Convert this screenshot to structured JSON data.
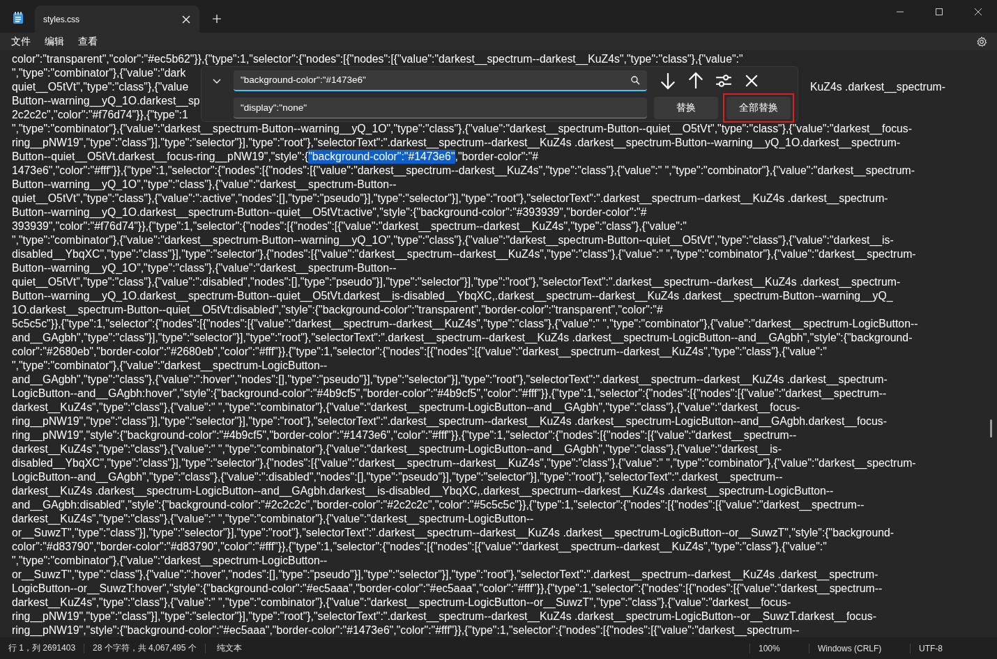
{
  "window": {
    "tab_title": "styles.css",
    "tab_selected": true
  },
  "menu": [
    "文件",
    "编辑",
    "查看"
  ],
  "find_panel": {
    "find_value": "\"background-color\":\"#1473e6\"",
    "replace_value": "\"display\":\"none\"",
    "replace_button": "替换",
    "replace_all_button": "全部替换",
    "replace_all_outlined": true
  },
  "editor_lines": [
    {
      "text": "color\":\"transparent\",\"color\":\"#ec5b62\"}},{\"type\":1,\"selector\":{\"nodes\":[{\"nodes\":[{\"value\":\"darkest__spectrum--darkest__KuZ4s\",\"type\":\"class\"},{\"value\":\""
    },
    {
      "text": "\",\"type\":\"combinator\"},{\"value\":\"dark"
    },
    {
      "text": "quiet__O5tVt\",\"type\":\"class\"},{\"value",
      "right": "KuZ4s .darkest__spectrum-"
    },
    {
      "text": "Button--warning__yQ_1O.darkest__sp"
    },
    {
      "text": "2c2c2c\",\"color\":\"#f76d74\"}},{\"type\":1"
    },
    {
      "text": "\",\"type\":\"combinator\"},{\"value\":\"darkest__spectrum-Button--warning__yQ_1O\",\"type\":\"class\"},{\"value\":\"darkest__spectrum-Button--quiet__O5tVt\",\"type\":\"class\"},{\"value\":\"darkest__focus-"
    },
    {
      "text": "ring__pNW19\",\"type\":\"class\"}],\"type\":\"selector\"}],\"type\":\"root\"},\"selectorText\":\".darkest__spectrum--darkest__KuZ4s .darkest__spectrum-Button--warning__yQ_1O.darkest__spectrum-"
    },
    {
      "text": "Button--quiet__O5tVt.darkest__focus-ring__pNW19\",\"style\":{",
      "match": "\"background-color\":\"#1473e6\"",
      "after": ",\"border-color\":\"#"
    },
    {
      "text": "1473e6\",\"color\":\"#fff\"}},{\"type\":1,\"selector\":{\"nodes\":[{\"nodes\":[{\"value\":\"darkest__spectrum--darkest__KuZ4s\",\"type\":\"class\"},{\"value\":\" \",\"type\":\"combinator\"},{\"value\":\"darkest__spectrum-"
    },
    {
      "text": "Button--warning__yQ_1O\",\"type\":\"class\"},{\"value\":\"darkest__spectrum-Button--"
    },
    {
      "text": "quiet__O5tVt\",\"type\":\"class\"},{\"value\":\":active\",\"nodes\":[],\"type\":\"pseudo\"}],\"type\":\"selector\"}],\"type\":\"root\"},\"selectorText\":\".darkest__spectrum--darkest__KuZ4s .darkest__spectrum-"
    },
    {
      "text": "Button--warning__yQ_1O.darkest__spectrum-Button--quiet__O5tVt:active\",\"style\":{\"background-color\":\"#393939\",\"border-color\":\"#"
    },
    {
      "text": "393939\",\"color\":\"#f76d74\"}},{\"type\":1,\"selector\":{\"nodes\":[{\"nodes\":[{\"value\":\"darkest__spectrum--darkest__KuZ4s\",\"type\":\"class\"},{\"value\":\""
    },
    {
      "text": "\",\"type\":\"combinator\"},{\"value\":\"darkest__spectrum-Button--warning__yQ_1O\",\"type\":\"class\"},{\"value\":\"darkest__spectrum-Button--quiet__O5tVt\",\"type\":\"class\"},{\"value\":\"darkest__is-"
    },
    {
      "text": "disabled__YbqXC\",\"type\":\"class\"}],\"type\":\"selector\"},{\"nodes\":[{\"value\":\"darkest__spectrum--darkest__KuZ4s\",\"type\":\"class\"},{\"value\":\" \",\"type\":\"combinator\"},{\"value\":\"darkest__spectrum-"
    },
    {
      "text": "Button--warning__yQ_1O\",\"type\":\"class\"},{\"value\":\"darkest__spectrum-Button--"
    },
    {
      "text": "quiet__O5tVt\",\"type\":\"class\"},{\"value\":\":disabled\",\"nodes\":[],\"type\":\"pseudo\"}],\"type\":\"selector\"}],\"type\":\"root\"},\"selectorText\":\".darkest__spectrum--darkest__KuZ4s .darkest__spectrum-"
    },
    {
      "text": "Button--warning__yQ_1O.darkest__spectrum-Button--quiet__O5tVt.darkest__is-disabled__YbqXC,.darkest__spectrum--darkest__KuZ4s .darkest__spectrum-Button--warning__yQ_"
    },
    {
      "text": "1O.darkest__spectrum-Button--quiet__O5tVt:disabled\",\"style\":{\"background-color\":\"transparent\",\"border-color\":\"transparent\",\"color\":\"#"
    },
    {
      "text": "5c5c5c\"}},{\"type\":1,\"selector\":{\"nodes\":[{\"nodes\":[{\"value\":\"darkest__spectrum--darkest__KuZ4s\",\"type\":\"class\"},{\"value\":\" \",\"type\":\"combinator\"},{\"value\":\"darkest__spectrum-LogicButton--"
    },
    {
      "text": "and__GAgbh\",\"type\":\"class\"}],\"type\":\"selector\"}],\"type\":\"root\"},\"selectorText\":\".darkest__spectrum--darkest__KuZ4s .darkest__spectrum-LogicButton--and__GAgbh\",\"style\":{\"background-"
    },
    {
      "text": "color\":\"#2680eb\",\"border-color\":\"#2680eb\",\"color\":\"#fff\"}},{\"type\":1,\"selector\":{\"nodes\":[{\"nodes\":[{\"value\":\"darkest__spectrum--darkest__KuZ4s\",\"type\":\"class\"},{\"value\":\""
    },
    {
      "text": "\",\"type\":\"combinator\"},{\"value\":\"darkest__spectrum-LogicButton--"
    },
    {
      "text": "and__GAgbh\",\"type\":\"class\"},{\"value\":\":hover\",\"nodes\":[],\"type\":\"pseudo\"}],\"type\":\"selector\"}],\"type\":\"root\"},\"selectorText\":\".darkest__spectrum--darkest__KuZ4s .darkest__spectrum-"
    },
    {
      "text": "LogicButton--and__GAgbh:hover\",\"style\":{\"background-color\":\"#4b9cf5\",\"border-color\":\"#4b9cf5\",\"color\":\"#fff\"}},{\"type\":1,\"selector\":{\"nodes\":[{\"nodes\":[{\"value\":\"darkest__spectrum--"
    },
    {
      "text": "darkest__KuZ4s\",\"type\":\"class\"},{\"value\":\" \",\"type\":\"combinator\"},{\"value\":\"darkest__spectrum-LogicButton--and__GAgbh\",\"type\":\"class\"},{\"value\":\"darkest__focus-"
    },
    {
      "text": "ring__pNW19\",\"type\":\"class\"}],\"type\":\"selector\"}],\"type\":\"root\"},\"selectorText\":\".darkest__spectrum--darkest__KuZ4s .darkest__spectrum-LogicButton--and__GAgbh.darkest__focus-"
    },
    {
      "text": "ring__pNW19\",\"style\":{\"background-color\":\"#4b9cf5\",\"border-color\":\"#1473e6\",\"color\":\"#fff\"}},{\"type\":1,\"selector\":{\"nodes\":[{\"nodes\":[{\"value\":\"darkest__spectrum--"
    },
    {
      "text": "darkest__KuZ4s\",\"type\":\"class\"},{\"value\":\" \",\"type\":\"combinator\"},{\"value\":\"darkest__spectrum-LogicButton--and__GAgbh\",\"type\":\"class\"},{\"value\":\"darkest__is-"
    },
    {
      "text": "disabled__YbqXC\",\"type\":\"class\"}],\"type\":\"selector\"},{\"nodes\":[{\"value\":\"darkest__spectrum--darkest__KuZ4s\",\"type\":\"class\"},{\"value\":\" \",\"type\":\"combinator\"},{\"value\":\"darkest__spectrum-"
    },
    {
      "text": "LogicButton--and__GAgbh\",\"type\":\"class\"},{\"value\":\":disabled\",\"nodes\":[],\"type\":\"pseudo\"}],\"type\":\"selector\"}],\"type\":\"root\"},\"selectorText\":\".darkest__spectrum--"
    },
    {
      "text": "darkest__KuZ4s .darkest__spectrum-LogicButton--and__GAgbh.darkest__is-disabled__YbqXC,.darkest__spectrum--darkest__KuZ4s .darkest__spectrum-LogicButton--"
    },
    {
      "text": "and__GAgbh:disabled\",\"style\":{\"background-color\":\"#2c2c2c\",\"border-color\":\"#2c2c2c\",\"color\":\"#5c5c5c\"}},{\"type\":1,\"selector\":{\"nodes\":[{\"nodes\":[{\"value\":\"darkest__spectrum--"
    },
    {
      "text": "darkest__KuZ4s\",\"type\":\"class\"},{\"value\":\" \",\"type\":\"combinator\"},{\"value\":\"darkest__spectrum-LogicButton--"
    },
    {
      "text": "or__SuwzT\",\"type\":\"class\"}],\"type\":\"selector\"}],\"type\":\"root\"},\"selectorText\":\".darkest__spectrum--darkest__KuZ4s .darkest__spectrum-LogicButton--or__SuwzT\",\"style\":{\"background-"
    },
    {
      "text": "color\":\"#d83790\",\"border-color\":\"#d83790\",\"color\":\"#fff\"}},{\"type\":1,\"selector\":{\"nodes\":[{\"nodes\":[{\"value\":\"darkest__spectrum--darkest__KuZ4s\",\"type\":\"class\"},{\"value\":\""
    },
    {
      "text": "\",\"type\":\"combinator\"},{\"value\":\"darkest__spectrum-LogicButton--"
    },
    {
      "text": "or__SuwzT\",\"type\":\"class\"},{\"value\":\":hover\",\"nodes\":[],\"type\":\"pseudo\"}],\"type\":\"selector\"}],\"type\":\"root\"},\"selectorText\":\".darkest__spectrum--darkest__KuZ4s .darkest__spectrum-"
    },
    {
      "text": "LogicButton--or__SuwzT:hover\",\"style\":{\"background-color\":\"#ec5aaa\",\"border-color\":\"#ec5aaa\",\"color\":\"#fff\"}},{\"type\":1,\"selector\":{\"nodes\":[{\"nodes\":[{\"value\":\"darkest__spectrum--"
    },
    {
      "text": "darkest__KuZ4s\",\"type\":\"class\"},{\"value\":\" \",\"type\":\"combinator\"},{\"value\":\"darkest__spectrum-LogicButton--or__SuwzT\",\"type\":\"class\"},{\"value\":\"darkest__focus-"
    },
    {
      "text": "ring__pNW19\",\"type\":\"class\"}],\"type\":\"selector\"}],\"type\":\"root\"},\"selectorText\":\".darkest__spectrum--darkest__KuZ4s .darkest__spectrum-LogicButton--or__SuwzT.darkest__focus-"
    },
    {
      "text": "ring__pNW19\",\"style\":{\"background-color\":\"#ec5aaa\",\"border-color\":\"#1473e6\",\"color\":\"#fff\"}},{\"type\":1,\"selector\":{\"nodes\":[{\"nodes\":[{\"value\":\"darkest__spectrum--"
    }
  ],
  "status_bar": {
    "position": "行 1，列 2691403",
    "selection": "28 个字符，共 4,067,495 个",
    "format": "纯文本",
    "zoom": "100%",
    "line_ending": "Windows (CRLF)",
    "encoding": "UTF-8"
  }
}
